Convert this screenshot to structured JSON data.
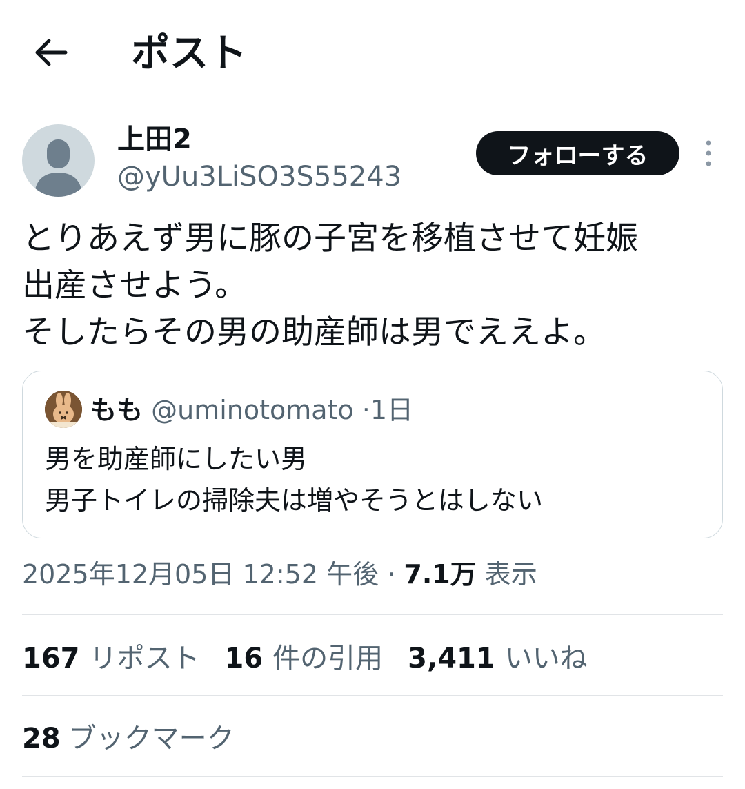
{
  "header": {
    "title": "ポスト"
  },
  "author": {
    "display_name": "上田2",
    "handle": "@yUu3LiSO3S55243",
    "follow_label": "フォローする"
  },
  "post": {
    "lines": [
      "とりあえず男に豚の子宮を移植させて妊娠",
      "出産させよう。",
      "そしたらその男の助産師は男でええよ。"
    ]
  },
  "quote": {
    "display_name": "もも",
    "handle": "@uminotomato",
    "separator": "·",
    "time": "1日",
    "lines": [
      "男を助産師にしたい男",
      "男子トイレの掃除夫は増やそうとはしない"
    ]
  },
  "meta": {
    "timestamp": "2025年12月05日 12:52 午後",
    "separator": "·",
    "views_count": "7.1万",
    "views_label": "表示"
  },
  "stats": {
    "reposts_count": "167",
    "reposts_label": "リポスト",
    "quotes_count": "16",
    "quotes_label": "件の引用",
    "likes_count": "3,411",
    "likes_label": "いいね",
    "bookmarks_count": "28",
    "bookmarks_label": "ブックマーク"
  },
  "icons": {
    "back": "arrow-left-icon",
    "more": "more-vertical-icon",
    "avatar": "default-avatar-icon"
  },
  "colors": {
    "text_primary": "#0f1419",
    "text_secondary": "#536471",
    "border": "#cfd9de",
    "follow_bg": "#0f1419"
  }
}
